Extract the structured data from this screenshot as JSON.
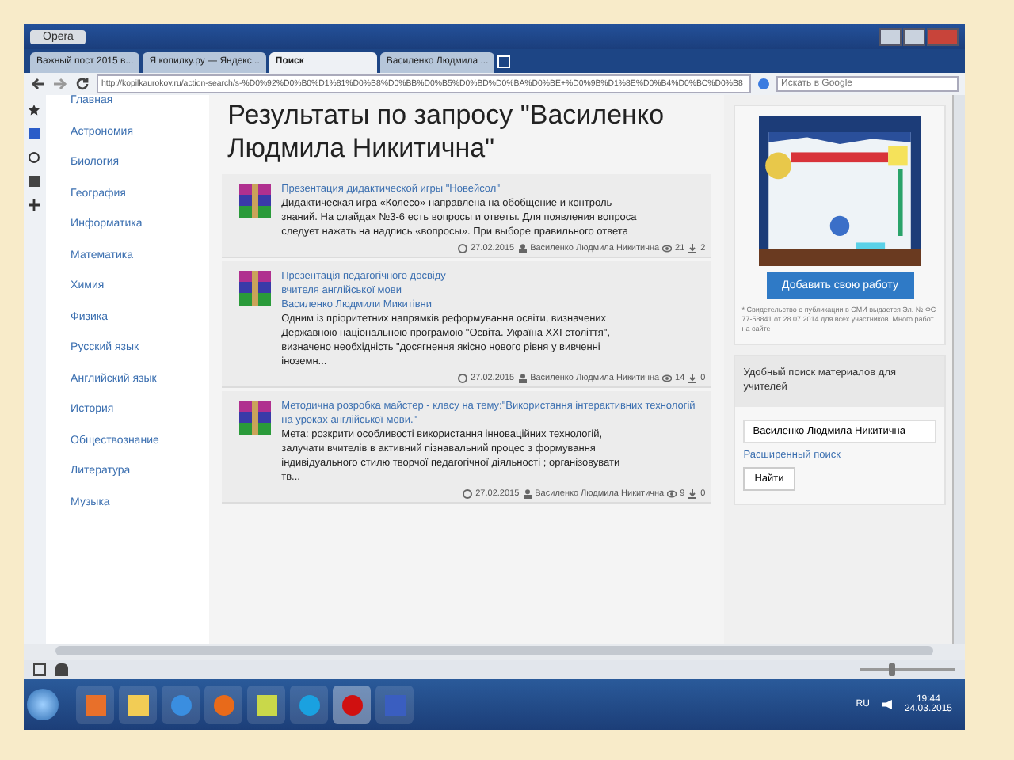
{
  "window": {
    "title": "Opera"
  },
  "tabs": [
    {
      "label": "Важный пост 2015 в...",
      "selected": false
    },
    {
      "label": "Я копилку.ру — Яндекс...",
      "selected": false
    },
    {
      "label": "Поиск",
      "selected": true
    },
    {
      "label": "Василенко Людмила ...",
      "selected": false
    }
  ],
  "address_bar": {
    "url": "http://kopilkaurokov.ru/action-search/s-%D0%92%D0%B0%D1%81%D0%B8%D0%BB%D0%B5%D0%BD%D0%BA%D0%BE+%D0%9B%D1%8E%D0%B4%D0%BC%D0%B8",
    "search_placeholder": "Искать в Google"
  },
  "zoom": {
    "level": 0.3
  },
  "nav": [
    "Главная",
    "Астрономия",
    "Биология",
    "География",
    "Информатика",
    "Математика",
    "Химия",
    "Физика",
    "Русский язык",
    "Английский язык",
    "История",
    "Обществознание",
    "Литература",
    "Музыка"
  ],
  "heading": "Результаты по запросу \"Василенко Людмила Никитична\"",
  "results": [
    {
      "title": [
        "Презентация дидактической игры \"Новейсол\""
      ],
      "text": "Дидактическая игра «Колесо» направлена на обобщение и контроль знаний. На слайдах №3-6 есть вопросы и ответы. Для появления вопроса следует нажать на надпись «вопросы». При выборе правильного ответа",
      "date": "27.02.2015",
      "author": "Василенко Людмила Никитична",
      "views": "21",
      "downloads": "2"
    },
    {
      "title": [
        "Презентація педагогічного досвіду",
        "вчителя англійської мови",
        "Василенко Людмили Микитівни"
      ],
      "text": "Одним із пріоритетних напрямків реформування освіти, визначених Державною національною програмою \"Освіта. Україна XXI століття\", визначено необхідність \"досягнення якісно нового рівня у вивченні іноземн...",
      "date": "27.02.2015",
      "author": "Василенко Людмила Никитична",
      "views": "14",
      "downloads": "0"
    },
    {
      "title": [
        "Методична розробка майстер - класу на тему:\"Використання інтерактивних технологій на уроках англійської мови.\""
      ],
      "text": "Мета: розкрити особливості використання інноваційних технологій, залучати вчителів в активний пізнавальний процес з формування індивідуального стилю творчої педагогічної діяльності ; організовувати тв...",
      "date": "27.02.2015",
      "author": "Василенко Людмила Никитична",
      "views": "9",
      "downloads": "0"
    }
  ],
  "sidebar": {
    "add_button": "Добавить свою работу",
    "note": "* Свидетельство о публикации в СМИ выдается Эл. № ФС 77-58841 от 28.07.2014 для всех участников. Много работ на сайте",
    "search_title": "Удобный поиск материалов для учителей",
    "search_value": "Василенко Людмила Никитична",
    "advanced_link": "Расширенный поиск",
    "find_button": "Найти"
  },
  "taskbar": {
    "language": "RU",
    "time": "19:44",
    "date": "24.03.2015"
  }
}
